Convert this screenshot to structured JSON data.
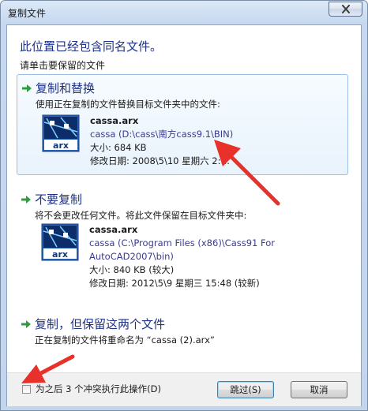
{
  "window": {
    "title": "复制文件"
  },
  "heading": "此位置已经包含同名文件。",
  "subheading": "请单击要保留的文件",
  "options": [
    {
      "title": "复制和替换",
      "description": "使用正在复制的文件替换目标文件夹中的文件:",
      "file": {
        "name": "cassa.arx",
        "path_lines": [
          "cassa (D:\\cass\\南方cass9.1\\BIN)"
        ],
        "size": "大小: 684 KB",
        "modified": "修改日期: 2008\\5\\10 星期六 2:…"
      }
    },
    {
      "title": "不要复制",
      "description": "将不会更改任何文件。将此文件保留在目标文件夹中:",
      "file": {
        "name": "cassa.arx",
        "path_lines": [
          "cassa (C:\\Program Files (x86)\\Cass91 For",
          "AutoCAD2007\\bin)"
        ],
        "size": "大小: 840 KB (较大)",
        "modified": "修改日期: 2012\\5\\9 星期三 15:48 (较新)"
      }
    },
    {
      "title": "复制，但保留这两个文件",
      "description": "正在复制的文件将重命名为 “cassa (2).arx”"
    }
  ],
  "footer": {
    "checkbox_label": "为之后 3 个冲突执行此操作(D)",
    "checkbox_checked": false,
    "skip_label": "跳过(S)",
    "cancel_label": "取消"
  },
  "icons": {
    "option_arrow": "green-arrow-icon",
    "file": "arx-file-icon",
    "close": "close-icon"
  },
  "colors": {
    "heading": "#1e3287",
    "selected_option_border": "#9bbfe6",
    "annotation_arrow": "#e8312a",
    "option_arrow": "#2e9e3c"
  }
}
